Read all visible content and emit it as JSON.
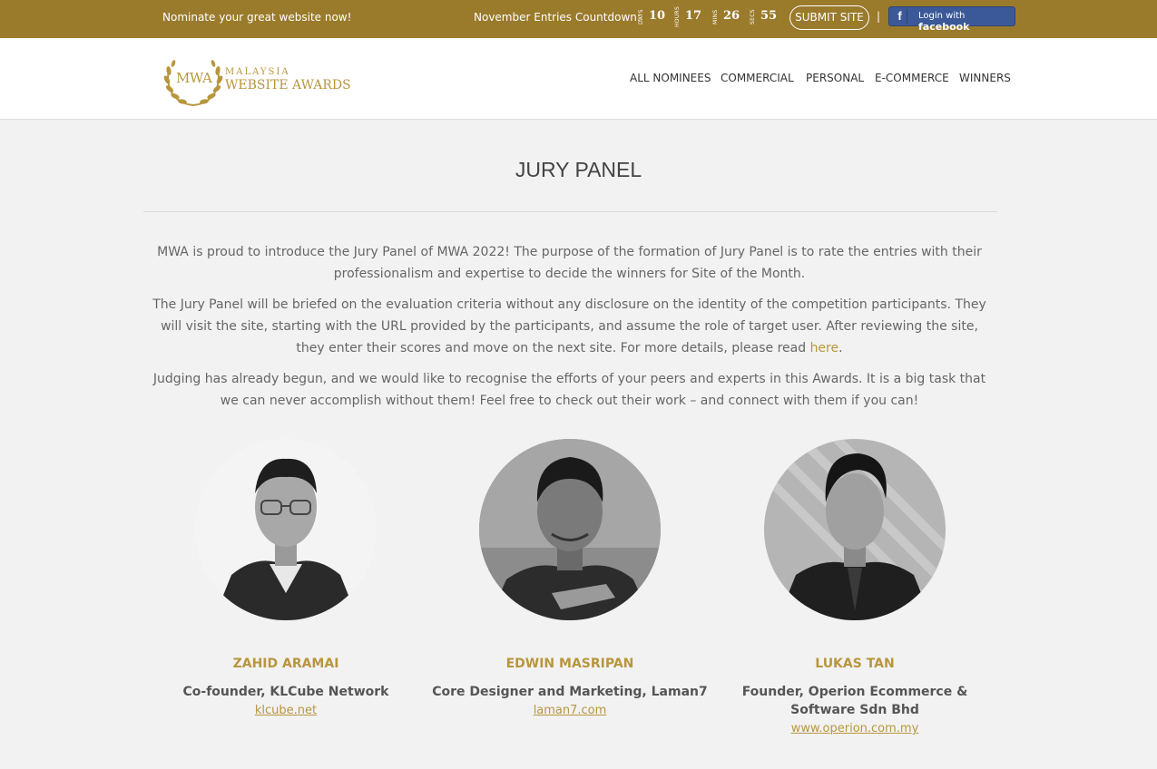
{
  "topbar": {
    "nominate": "Nominate your great website now!",
    "countdown_label": "November Entries Countdown:",
    "countdown": [
      {
        "unit": "DAYS",
        "value": "10"
      },
      {
        "unit": "HOURS",
        "value": "17"
      },
      {
        "unit": "MINS",
        "value": "26"
      },
      {
        "unit": "SECS",
        "value": "55"
      }
    ],
    "submit_label": "SUBMIT SITE",
    "separator": "|",
    "fb_icon": "f",
    "fb_text": "Login with",
    "fb_brand": "facebook"
  },
  "header": {
    "logo_mark": "MWA",
    "logo_line1": "MALAYSIA",
    "logo_line2": "WEBSITE AWARDS",
    "nav": [
      "ALL NOMINEES",
      "COMMERCIAL",
      "PERSONAL",
      "E-COMMERCE",
      "WINNERS"
    ]
  },
  "main": {
    "title": "JURY PANEL",
    "para1": "MWA is proud to introduce the Jury Panel of MWA 2022! The purpose of the formation of Jury Panel is to rate the entries with their professionalism and expertise to decide the winners for Site of the Month.",
    "para2": "The Jury Panel will be briefed on the evaluation criteria without any disclosure on the identity of the competition participants. They will visit the site, starting with the URL provided by the participants, and assume the role of target user. After reviewing the site, they enter their scores and move on the next site. For more details, please read ",
    "para2_link": "here",
    "para2_end": ".",
    "para3": "Judging has already begun, and we would like to recognise the efforts of your peers and experts in this Awards. It is a big task that we can never accomplish without them! Feel free to check out their work – and connect with them if you can!"
  },
  "jury": [
    {
      "name": "ZAHID ARAMAI",
      "role": "Co-founder, KLCube Network",
      "link": "klcube.net"
    },
    {
      "name": "EDWIN MASRIPAN",
      "role": "Core Designer and Marketing, Laman7",
      "link": "laman7.com"
    },
    {
      "name": "LUKAS TAN",
      "role": "Founder, Operion Ecommerce & Software Sdn Bhd",
      "link": "www.operion.com.my"
    }
  ],
  "colors": {
    "gold": "#9a7a2b",
    "accent": "#b8963e",
    "facebook": "#3b5998"
  }
}
